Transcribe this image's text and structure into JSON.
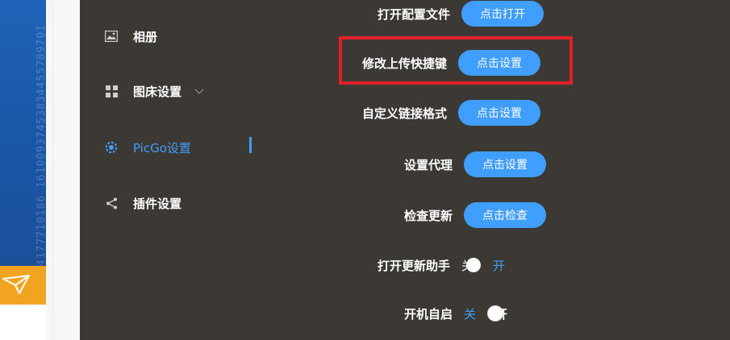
{
  "background_strip": {
    "digits": "1144557455594177710186 16100937453834455789701",
    "accent": "#1f63b8",
    "icon": "paper-plane-icon"
  },
  "sidebar": {
    "items": [
      {
        "label": "相册",
        "icon": "image-icon"
      },
      {
        "label": "图床设置",
        "icon": "grid-icon",
        "has_chevron": true
      },
      {
        "label": "PicGo设置",
        "icon": "settings-gear-icon",
        "active": true
      },
      {
        "label": "插件设置",
        "icon": "share-icon"
      }
    ]
  },
  "settings": {
    "rows": [
      {
        "label": "打开配置文件",
        "button": "点击打开"
      },
      {
        "label": "修改上传快捷键",
        "button": "点击设置",
        "highlighted": true
      },
      {
        "label": "自定义链接格式",
        "button": "点击设置"
      },
      {
        "label": "设置代理",
        "button": "点击设置"
      },
      {
        "label": "检查更新",
        "button": "点击检查"
      }
    ],
    "toggles": [
      {
        "label": "打开更新助手",
        "off_text": "关",
        "on_text": "开",
        "state": "on"
      },
      {
        "label": "开机自启",
        "off_text": "关",
        "on_text": "开",
        "state": "off"
      }
    ]
  },
  "colors": {
    "accent": "#409eff",
    "app_bg": "#3c3834",
    "highlight": "#e0212a",
    "side_orange": "#f2a420"
  }
}
